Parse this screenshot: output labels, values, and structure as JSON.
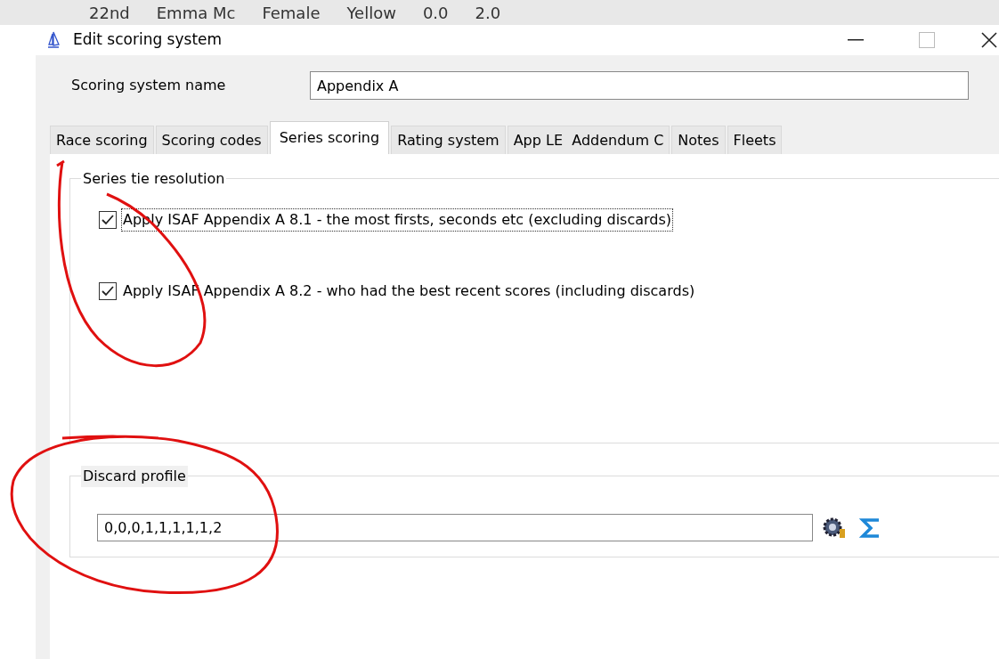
{
  "background_table": {
    "cells": [
      "22nd",
      "Emma Mc",
      "Female",
      "Yellow",
      "0.0",
      "2.0"
    ]
  },
  "window": {
    "title": "Edit scoring system"
  },
  "name_field": {
    "label": "Scoring system name",
    "value": "Appendix A"
  },
  "tabs": [
    {
      "label": "Race scoring",
      "selected": false
    },
    {
      "label": "Scoring codes",
      "selected": false
    },
    {
      "label": "Series scoring",
      "selected": true
    },
    {
      "label": "Rating system",
      "selected": false
    },
    {
      "label": "App LE  Addendum C",
      "selected": false
    },
    {
      "label": "Notes",
      "selected": false
    },
    {
      "label": "Fleets",
      "selected": false
    }
  ],
  "tie_resolution": {
    "title": "Series tie resolution",
    "options": [
      {
        "label": "Apply ISAF Appendix A 8.1 - the most firsts, seconds etc (excluding discards)",
        "checked": true,
        "focused": true
      },
      {
        "label": "Apply ISAF Appendix A 8.2 - who had the best recent scores (including discards)",
        "checked": true,
        "focused": false
      }
    ]
  },
  "discard_profile": {
    "title": "Discard profile",
    "value": "0,0,0,1,1,1,1,1,2"
  }
}
